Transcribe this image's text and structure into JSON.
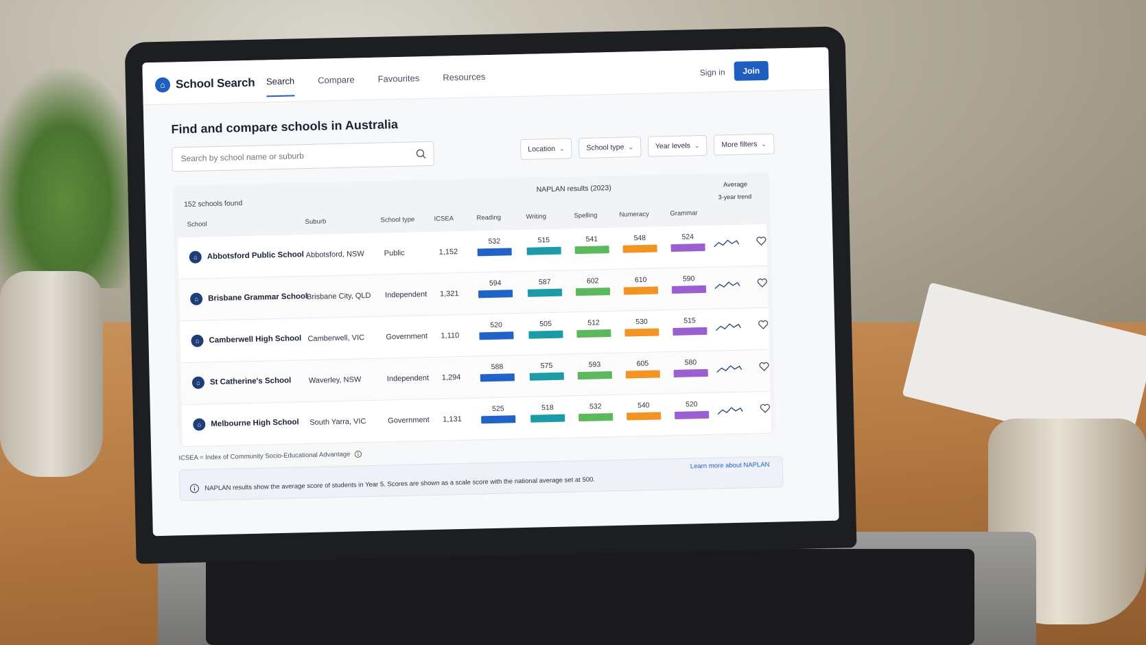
{
  "app": {
    "name": "School Search"
  },
  "nav": {
    "tabs": [
      "Search",
      "Compare",
      "Favourites",
      "Resources"
    ],
    "active_tab": "Search",
    "sign_in": "Sign in",
    "join": "Join"
  },
  "page": {
    "title": "Find and compare schools in Australia"
  },
  "search": {
    "placeholder": "Search by school name or suburb"
  },
  "filters": [
    "Location",
    "School type",
    "Year levels",
    "More filters"
  ],
  "table": {
    "count": "152 schools found",
    "naplan_heading": "NAPLAN results (2023)",
    "average_heading": "Average",
    "trend_heading": "3-year trend",
    "columns": {
      "school": "School",
      "suburb": "Suburb",
      "school_type": "School type",
      "icsea": "ICSEA",
      "reading": "Reading",
      "writing": "Writing",
      "spelling": "Spelling",
      "numeracy": "Numeracy",
      "grammar": "Grammar"
    },
    "rows": [
      {
        "school": "Abbotsford Public School",
        "suburb": "Abbotsford, NSW",
        "type": "Public",
        "icsea": "1,152",
        "reading": "532",
        "writing": "515",
        "spelling": "541",
        "numeracy": "548",
        "grammar": "524"
      },
      {
        "school": "Brisbane Grammar School",
        "suburb": "Brisbane City, QLD",
        "type": "Independent",
        "icsea": "1,321",
        "reading": "594",
        "writing": "587",
        "spelling": "602",
        "numeracy": "610",
        "grammar": "590"
      },
      {
        "school": "Camberwell High School",
        "suburb": "Camberwell, VIC",
        "type": "Government",
        "icsea": "1,110",
        "reading": "520",
        "writing": "505",
        "spelling": "512",
        "numeracy": "530",
        "grammar": "515"
      },
      {
        "school": "St Catherine's School",
        "suburb": "Waverley, NSW",
        "type": "Independent",
        "icsea": "1,294",
        "reading": "588",
        "writing": "575",
        "spelling": "593",
        "numeracy": "605",
        "grammar": "580"
      },
      {
        "school": "Melbourne High School",
        "suburb": "South Yarra, VIC",
        "type": "Government",
        "icsea": "1,131",
        "reading": "525",
        "writing": "518",
        "spelling": "532",
        "numeracy": "540",
        "grammar": "520"
      }
    ]
  },
  "colors": {
    "accent": "#1f5fbf",
    "reading": "#1f63c6",
    "writing": "#1c9aa6",
    "spelling": "#5cb85c",
    "numeracy": "#f29423",
    "grammar": "#9b5fd1"
  },
  "icons": {
    "logo": "school-shield-icon",
    "search": "search-icon",
    "filter": "chevron-down-icon",
    "trend": "sparkline-icon",
    "favourite": "heart-icon",
    "info": "info-icon"
  },
  "footer": {
    "icsea_note": "ICSEA = Index of Community Socio-Educational Advantage",
    "info_text": "NAPLAN results show the average score of students in Year 5. Scores are shown as a scale score with the national average set at 500.",
    "learn_more": "Learn more about NAPLAN"
  }
}
